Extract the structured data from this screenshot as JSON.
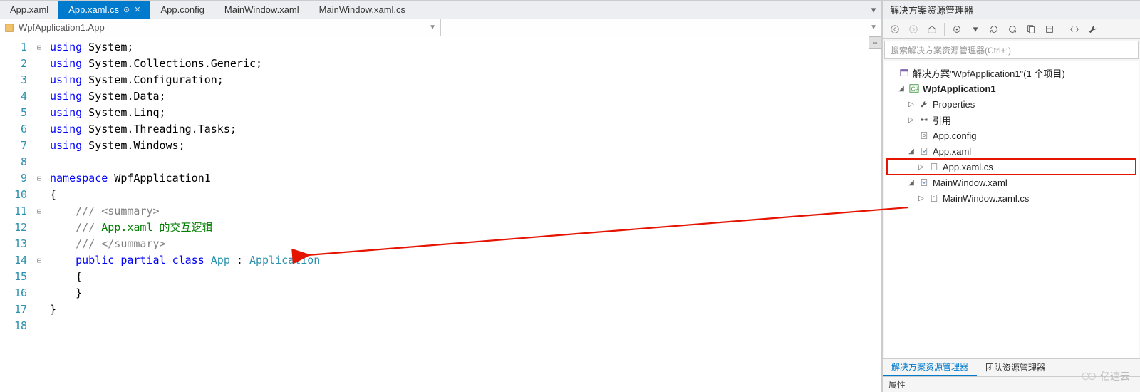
{
  "tabs": {
    "items": [
      {
        "label": "App.xaml",
        "active": false
      },
      {
        "label": "App.xaml.cs",
        "active": true,
        "pinned": true,
        "closable": true
      },
      {
        "label": "App.config",
        "active": false
      },
      {
        "label": "MainWindow.xaml",
        "active": false
      },
      {
        "label": "MainWindow.xaml.cs",
        "active": false
      }
    ]
  },
  "navbar": {
    "left": "WpfApplication1.App",
    "right": ""
  },
  "code": {
    "lines": [
      {
        "n": 1,
        "fold": "⊟",
        "html": "<span class='kw'>using</span> System;"
      },
      {
        "n": 2,
        "fold": "",
        "html": "<span class='kw'>using</span> System.Collections.Generic;"
      },
      {
        "n": 3,
        "fold": "",
        "html": "<span class='kw'>using</span> System.Configuration;"
      },
      {
        "n": 4,
        "fold": "",
        "html": "<span class='kw'>using</span> System.Data;"
      },
      {
        "n": 5,
        "fold": "",
        "html": "<span class='kw'>using</span> System.Linq;"
      },
      {
        "n": 6,
        "fold": "",
        "html": "<span class='kw'>using</span> System.Threading.Tasks;"
      },
      {
        "n": 7,
        "fold": "",
        "html": "<span class='kw'>using</span> System.Windows;"
      },
      {
        "n": 8,
        "fold": "",
        "html": ""
      },
      {
        "n": 9,
        "fold": "⊟",
        "html": "<span class='kw'>namespace</span> WpfApplication1"
      },
      {
        "n": 10,
        "fold": "",
        "html": "{"
      },
      {
        "n": 11,
        "fold": "⊟",
        "html": "    <span class='gy'>/// &lt;summary&gt;</span>"
      },
      {
        "n": 12,
        "fold": "",
        "html": "    <span class='gy'>///</span> <span class='cm'>App.xaml 的交互逻辑</span>"
      },
      {
        "n": 13,
        "fold": "",
        "html": "    <span class='gy'>/// &lt;/summary&gt;</span>"
      },
      {
        "n": 14,
        "fold": "⊟",
        "html": "    <span class='kw'>public</span> <span class='kw'>partial</span> <span class='kw'>class</span> <span class='ty'>App</span> : <span class='ty'>Application</span>"
      },
      {
        "n": 15,
        "fold": "",
        "html": "    {"
      },
      {
        "n": 16,
        "fold": "",
        "html": "    }"
      },
      {
        "n": 17,
        "fold": "",
        "html": "}"
      },
      {
        "n": 18,
        "fold": "",
        "html": ""
      }
    ]
  },
  "solution_explorer": {
    "title": "解决方案资源管理器",
    "search_placeholder": "搜索解决方案资源管理器(Ctrl+;)",
    "solution_label": "解决方案\"WpfApplication1\"(1 个项目)",
    "project": "WpfApplication1",
    "nodes": {
      "properties": "Properties",
      "references": "引用",
      "appconfig": "App.config",
      "appxaml": "App.xaml",
      "appxamlcs": "App.xaml.cs",
      "mainwin": "MainWindow.xaml",
      "mainwincs": "MainWindow.xaml.cs"
    },
    "bottom_tabs": {
      "active": "解决方案资源管理器",
      "other": "团队资源管理器"
    },
    "properties_panel": "属性"
  },
  "watermark": "亿速云"
}
